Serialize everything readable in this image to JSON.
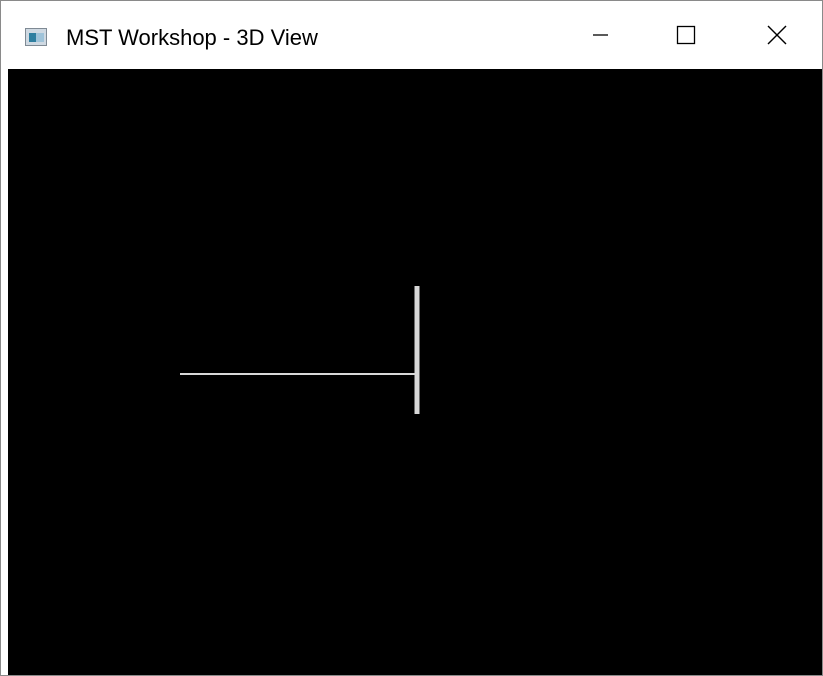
{
  "window": {
    "title": "MST Workshop - 3D View",
    "icon": "app-window-icon"
  },
  "titlebar_buttons": {
    "minimize": "minimize-icon",
    "maximize": "maximize-icon",
    "close": "close-icon"
  },
  "viewport": {
    "background": "#000000",
    "line_color": "#d8d8d8"
  }
}
